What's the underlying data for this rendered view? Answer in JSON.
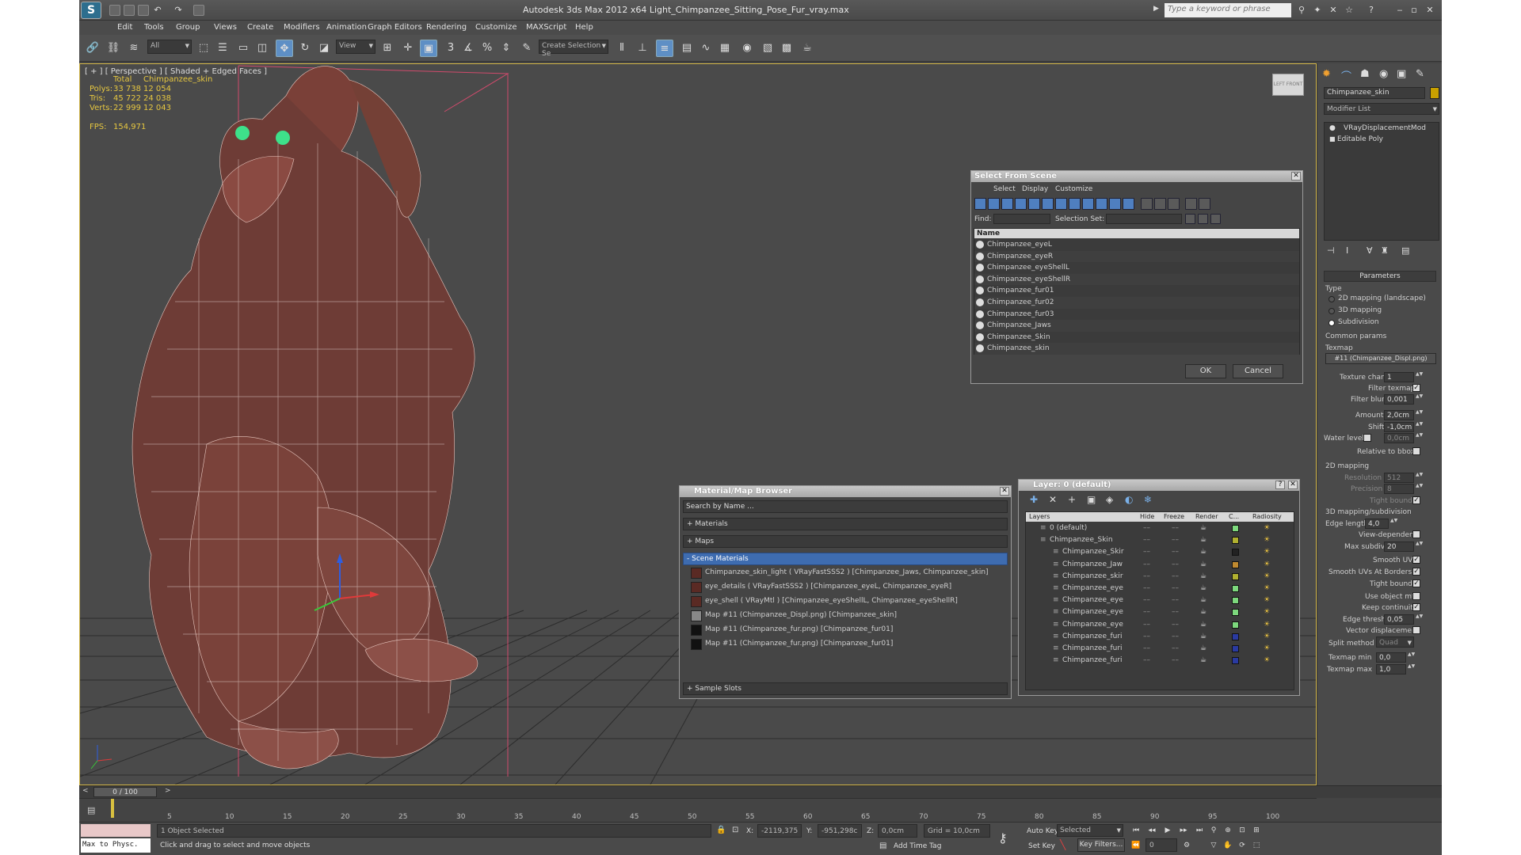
{
  "window": {
    "title": "Autodesk 3ds Max  2012 x64    Light_Chimpanzee_Sitting_Pose_Fur_vray.max",
    "search_placeholder": "Type a keyword or phrase"
  },
  "menu": [
    "Edit",
    "Tools",
    "Group",
    "Views",
    "Create",
    "Modifiers",
    "Animation",
    "Graph Editors",
    "Rendering",
    "Customize",
    "MAXScript",
    "Help"
  ],
  "toolbar": {
    "selection_filter": "All",
    "ref_coord": "View",
    "named_selection": "Create Selection Se",
    "snap_angle": "3",
    "snap_percent": "%"
  },
  "viewport": {
    "label": "[ + ] [ Perspective ] [ Shaded + Edged Faces ]",
    "stats": {
      "col_total": "Total",
      "col_object": "Chimpanzee_skin",
      "rows": [
        {
          "label": "Polys:",
          "total": "33 738",
          "obj": "12 054"
        },
        {
          "label": "Tris:",
          "total": "45 722",
          "obj": "24 038"
        },
        {
          "label": "Verts:",
          "total": "22 999",
          "obj": "12 043"
        }
      ],
      "fps_label": "FPS:",
      "fps": "154,971"
    },
    "viewcube_labels": [
      "LEFT",
      "FRONT"
    ]
  },
  "command_panel": {
    "object_name": "Chimpanzee_skin",
    "object_color": "#c8a000",
    "modifier_list": "Modifier List",
    "stack": [
      "VRayDisplacementMod",
      "Editable Poly"
    ],
    "rollout": "Parameters",
    "type_label": "Type",
    "types": [
      {
        "label": "2D mapping (landscape)",
        "selected": false
      },
      {
        "label": "3D mapping",
        "selected": false
      },
      {
        "label": "Subdivision",
        "selected": true
      }
    ],
    "common_params": "Common params",
    "texmap_label": "Texmap",
    "texmap": "#11 (Chimpanzee_Displ.png)",
    "texture_chan_label": "Texture chan",
    "texture_chan": "1",
    "filter_texmap": "Filter texmap",
    "filter_blur_label": "Filter blur",
    "filter_blur": "0,001",
    "amount_label": "Amount",
    "amount": "2,0cm",
    "shift_label": "Shift",
    "shift": "-1,0cm",
    "water_level_label": "Water level",
    "water_level": "0,0cm",
    "relative_bbox": "Relative to bbox",
    "mapping2d": "2D mapping",
    "resolution_label": "Resolution",
    "resolution": "512",
    "precision_label": "Precision",
    "precision": "8",
    "tight_bounds": "Tight bounds",
    "mapping3d": "3D mapping/subdivision",
    "edge_length_label": "Edge length",
    "edge_length": "4,0",
    "view_dependent": "View-dependent",
    "max_subdivs_label": "Max subdivs",
    "max_subdivs": "20",
    "smooth_uvs": "Smooth UVs",
    "smooth_uvs_borders": "Smooth UVs At Borders",
    "tight_bounds2": "Tight bounds",
    "use_object_mtl": "Use object mtl",
    "keep_continuity": "Keep continuity",
    "edge_thresh_label": "Edge thresh",
    "edge_thresh": "0,05",
    "vector_displacement": "Vector displacement",
    "split_method_label": "Split method",
    "split_method": "Quad",
    "texmap_min_label": "Texmap min",
    "texmap_min": "0,0",
    "texmap_max_label": "Texmap max",
    "texmap_max": "1,0"
  },
  "select_dialog": {
    "title": "Select From Scene",
    "menu": [
      "Select",
      "Display",
      "Customize"
    ],
    "find_label": "Find:",
    "selection_set_label": "Selection Set:",
    "column": "Name",
    "items": [
      "Chimpanzee_eyeL",
      "Chimpanzee_eyeR",
      "Chimpanzee_eyeShellL",
      "Chimpanzee_eyeShellR",
      "Chimpanzee_fur01",
      "Chimpanzee_fur02",
      "Chimpanzee_fur03",
      "Chimpanzee_Jaws",
      "Chimpanzee_Skin",
      "Chimpanzee_skin"
    ],
    "ok": "OK",
    "cancel": "Cancel"
  },
  "material_browser": {
    "title": "Material/Map Browser",
    "search": "Search by Name ...",
    "groups": [
      "+ Materials",
      "+ Maps"
    ],
    "scene_group": "- Scene Materials",
    "items": [
      "Chimpanzee_skin_light  ( VRayFastSSS2 )  [Chimpanzee_Jaws, Chimpanzee_skin]",
      "eye_details  ( VRayFastSSS2 )  [Chimpanzee_eyeL, Chimpanzee_eyeR]",
      "eye_shell  ( VRayMtl )  [Chimpanzee_eyeShellL, Chimpanzee_eyeShellR]",
      "Map #11 (Chimpanzee_Displ.png)  [Chimpanzee_skin]",
      "Map #11 (Chimpanzee_fur.png)  [Chimpanzee_fur01]",
      "Map #11 (Chimpanzee_fur.png)  [Chimpanzee_fur01]"
    ],
    "sample_slots": "+ Sample Slots"
  },
  "layer_dialog": {
    "title": "Layer: 0 (default)",
    "columns": [
      "Layers",
      "Hide",
      "Freeze",
      "Render",
      "C...",
      "Radiosity"
    ],
    "rows": [
      {
        "name": "0 (default)",
        "color": "#7dd87d",
        "indent": 0
      },
      {
        "name": "Chimpanzee_Skin",
        "color": "#b0b030",
        "indent": 0
      },
      {
        "name": "Chimpanzee_Skir",
        "color": "#222222",
        "indent": 1
      },
      {
        "name": "Chimpanzee_Jaw",
        "color": "#c08a30",
        "indent": 1
      },
      {
        "name": "Chimpanzee_skir",
        "color": "#b0b030",
        "indent": 1
      },
      {
        "name": "Chimpanzee_eye",
        "color": "#7dd87d",
        "indent": 1
      },
      {
        "name": "Chimpanzee_eye",
        "color": "#7dd87d",
        "indent": 1
      },
      {
        "name": "Chimpanzee_eye",
        "color": "#7dd87d",
        "indent": 1
      },
      {
        "name": "Chimpanzee_eye",
        "color": "#7dd87d",
        "indent": 1
      },
      {
        "name": "Chimpanzee_furi",
        "color": "#2a3aa0",
        "indent": 1
      },
      {
        "name": "Chimpanzee_furi",
        "color": "#2a3aa0",
        "indent": 1
      },
      {
        "name": "Chimpanzee_furi",
        "color": "#2a3aa0",
        "indent": 1
      }
    ]
  },
  "timeline": {
    "frame": "0 / 100",
    "ticks": [
      "5",
      "10",
      "15",
      "20",
      "25",
      "30",
      "35",
      "40",
      "45",
      "50",
      "55",
      "60",
      "65",
      "70",
      "75",
      "80",
      "85",
      "90",
      "95",
      "100"
    ]
  },
  "status": {
    "maxscript": "Max to Physc.",
    "selected": "1 Object Selected",
    "prompt": "Click and drag to select and move objects",
    "x_label": "X:",
    "x": "-2119,375",
    "y_label": "Y:",
    "y": "-951,298c",
    "z_label": "Z:",
    "z": "0,0cm",
    "grid": "Grid = 10,0cm",
    "add_time_tag": "Add Time Tag",
    "auto_key": "Auto Key",
    "set_key": "Set Key",
    "key_mode": "Selected",
    "key_filters": "Key Filters...",
    "current_frame": "0"
  }
}
